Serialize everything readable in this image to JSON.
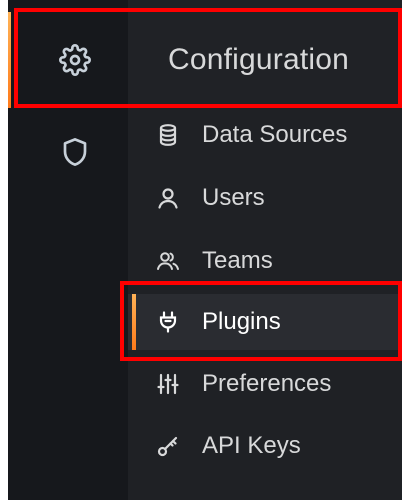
{
  "sidebar": {
    "config_icon": "gear-icon",
    "shield_icon": "shield-icon"
  },
  "menu": {
    "header": "Configuration",
    "items": [
      {
        "label": "Data Sources",
        "icon": "database-icon"
      },
      {
        "label": "Users",
        "icon": "user-icon"
      },
      {
        "label": "Teams",
        "icon": "users-icon"
      },
      {
        "label": "Plugins",
        "icon": "plug-icon",
        "active": true
      },
      {
        "label": "Preferences",
        "icon": "sliders-icon"
      },
      {
        "label": "API Keys",
        "icon": "key-icon"
      }
    ]
  },
  "colors": {
    "highlight": "#ff0000",
    "accent": "#ff9830"
  }
}
